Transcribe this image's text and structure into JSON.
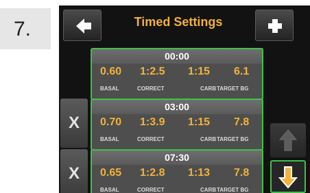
{
  "step": {
    "number": "7."
  },
  "header": {
    "title": "Timed Settings",
    "back_icon": "arrow-left-icon",
    "add_icon": "plus-icon"
  },
  "labels": {
    "basal": "BASAL",
    "correct": "CORRECT",
    "carb": "CARB",
    "target_bg": "TARGET BG"
  },
  "segments": [
    {
      "time": "00:00",
      "basal": "0.60",
      "correct": "1:2.5",
      "carb": "1:15",
      "target_bg": "6.1",
      "delete_label": ""
    },
    {
      "time": "03:00",
      "basal": "0.70",
      "correct": "1:3.9",
      "carb": "1:15",
      "target_bg": "7.8",
      "delete_label": "X"
    },
    {
      "time": "07:30",
      "basal": "0.65",
      "correct": "1:2.8",
      "carb": "1:13",
      "target_bg": "7.8",
      "delete_label": "X"
    }
  ],
  "scroll": {
    "up_icon": "arrow-up-icon",
    "down_icon": "arrow-down-icon"
  },
  "colors": {
    "accent": "#f2b23c",
    "selection": "#3fc24a",
    "background": "#121212"
  }
}
